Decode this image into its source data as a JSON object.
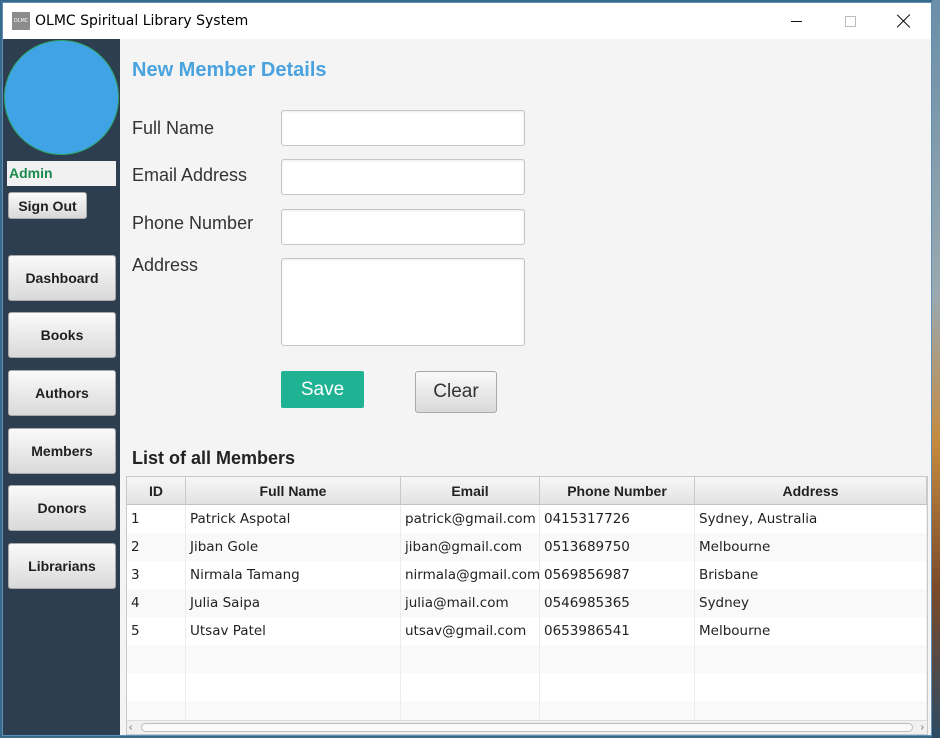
{
  "window": {
    "title": "OLMC Spiritual Library System",
    "icon_text": "OLMC"
  },
  "sidebar": {
    "user_label": "Admin",
    "sign_out_label": "Sign Out",
    "nav": [
      {
        "label": "Dashboard"
      },
      {
        "label": "Books"
      },
      {
        "label": "Authors"
      },
      {
        "label": "Members"
      },
      {
        "label": "Donors"
      },
      {
        "label": "Librarians"
      }
    ]
  },
  "form": {
    "title": "New Member Details",
    "full_name_label": "Full Name",
    "full_name_value": "",
    "email_label": "Email Address",
    "email_value": "",
    "phone_label": "Phone Number",
    "phone_value": "",
    "address_label": "Address",
    "address_value": "",
    "save_label": "Save",
    "clear_label": "Clear"
  },
  "members_table": {
    "title": "List of all Members",
    "columns": [
      "ID",
      "Full Name",
      "Email",
      "Phone Number",
      "Address"
    ],
    "rows": [
      [
        "1",
        "Patrick Aspotal",
        "patrick@gmail.com",
        "0415317726",
        "Sydney, Australia"
      ],
      [
        "2",
        "Jiban Gole",
        "jiban@gmail.com",
        "0513689750",
        "Melbourne"
      ],
      [
        "3",
        "Nirmala Tamang",
        "nirmala@gmail.com",
        "0569856987",
        "Brisbane"
      ],
      [
        "4",
        "Julia Saipa",
        "julia@mail.com",
        "0546985365",
        "Sydney"
      ],
      [
        "5",
        "Utsav Patel",
        "utsav@gmail.com",
        "0653986541",
        "Melbourne"
      ]
    ]
  },
  "colors": {
    "sidebar_bg": "#2c3e50",
    "accent_blue": "#4aa3df",
    "save_green": "#1fb394",
    "admin_green": "#1a8a4d"
  }
}
